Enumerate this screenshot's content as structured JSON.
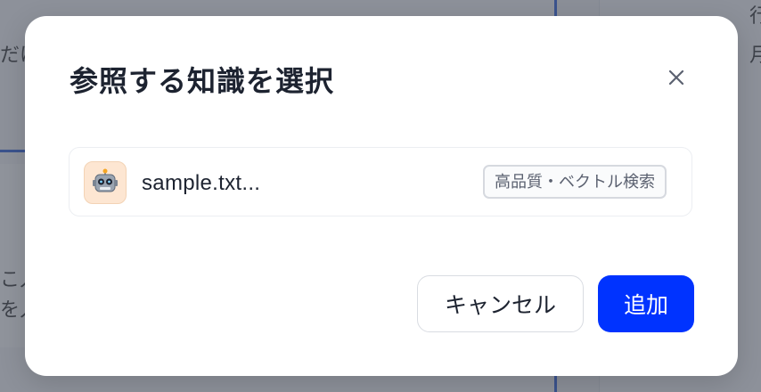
{
  "background": {
    "left_snippets": [
      "だけ",
      "こ入",
      "を入"
    ],
    "right_snippets": [
      "行",
      "月"
    ]
  },
  "modal": {
    "title": "参照する知識を選択",
    "close_icon": "close-icon",
    "items": [
      {
        "icon": "robot-icon",
        "name": "sample.txt...",
        "badge": "高品質・ベクトル検索"
      }
    ],
    "cancel_label": "キャンセル",
    "add_label": "追加"
  },
  "colors": {
    "primary": "#0033ff",
    "title_text": "#1d2330",
    "badge_border": "#d6d9df"
  }
}
